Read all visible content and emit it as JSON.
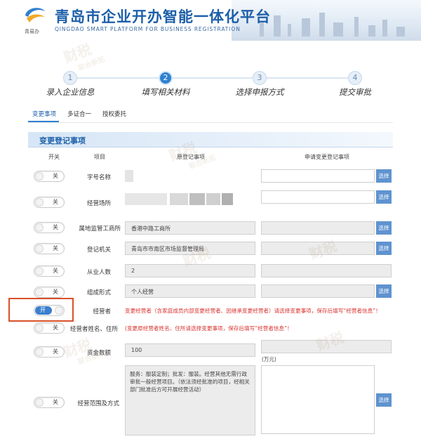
{
  "header": {
    "title": "青岛市企业开办智能一体化平台",
    "subtitle": "QINGDAO SMART PLATFORM FOR BUSINESS REGISTRATION",
    "logo_text": "青易办"
  },
  "steps": [
    {
      "num": "1",
      "label": "录入企业信息"
    },
    {
      "num": "2",
      "label": "填写相关材料"
    },
    {
      "num": "3",
      "label": "选择申报方式"
    },
    {
      "num": "4",
      "label": "提交审批"
    }
  ],
  "tabs": [
    "变更事项",
    "多证合一",
    "授权委托"
  ],
  "section": {
    "title": "变更登记事项",
    "columns": [
      "开关",
      "项目",
      "原登记事项",
      "申请变更登记事项"
    ]
  },
  "toggle_off": "关",
  "toggle_on": "开",
  "select_label": "选择",
  "rows": {
    "name": {
      "label": "字号名称"
    },
    "place": {
      "label": "经营场所"
    },
    "bureau": {
      "label": "属地监管工商所",
      "value": "香港中路工商所"
    },
    "authority": {
      "label": "登记机关",
      "value": "青岛市市南区市场监督管理局"
    },
    "staff": {
      "label": "从业人数",
      "value": "2"
    },
    "form": {
      "label": "组成形式",
      "value": "个人经营"
    },
    "operator": {
      "label": "经营者",
      "warning": "变更经营者（含家庭成员内部变更经营者、因继承变更经营者）请选择变更事项，保存后填写“经营者信息”！"
    },
    "operator_info": {
      "label": "经营者姓名、住所",
      "warning": "(变更原经营者姓名、住所请选择变更事项，保存后填写“经营者信息”！"
    },
    "capital": {
      "label": "资金数额",
      "value": "100",
      "unit": "(万元)"
    },
    "scope": {
      "label": "经营范围及方式",
      "value": "服务：服装定制；批发：服装。经营其他无需行政审批一般经营项目。（依法须经批准的项目，经相关部门批准后方可开展经营活动）"
    }
  },
  "watermark": {
    "line1": "财税",
    "line2": "联合新拓"
  }
}
